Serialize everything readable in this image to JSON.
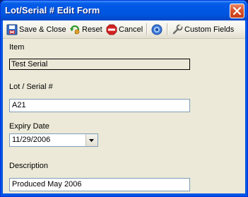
{
  "window": {
    "title": "Lot/Serial # Edit Form"
  },
  "toolbar": {
    "save_close_label": "Save & Close",
    "reset_label": "Reset",
    "cancel_label": "Cancel",
    "custom_fields_label": "Custom Fields"
  },
  "form": {
    "item": {
      "label": "Item",
      "value": "Test Serial"
    },
    "lot_serial": {
      "label": "Lot / Serial #",
      "value": "A21"
    },
    "expiry_date": {
      "label": "Expiry Date",
      "value": "11/29/2006"
    },
    "description": {
      "label": "Description",
      "value": "Produced May 2006"
    }
  },
  "colors": {
    "title_bar": "#0058e6",
    "client_bg": "#ece9d8",
    "input_border": "#7f9db9",
    "close_button": "#d9542d"
  },
  "icons": [
    "save-icon",
    "reset-icon",
    "stop-icon",
    "help-icon",
    "wrench-icon",
    "close-icon",
    "dropdown-arrow-icon"
  ]
}
